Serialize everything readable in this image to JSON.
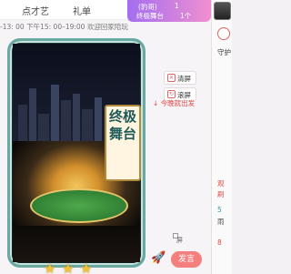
{
  "tabs": [
    {
      "label": "点才艺"
    },
    {
      "label": "礼单"
    }
  ],
  "banner": {
    "line1_a": "(豹哥)",
    "line1_b": "1",
    "line2_a": "终极舞台",
    "line2_b": "1个"
  },
  "notice": "-13: 00 下午15: 00–19:00 欢迎回家陪玩",
  "poster": {
    "title": "终极舞台"
  },
  "side_buttons": {
    "clear_label": "清屏",
    "scroll_label": "滚屏"
  },
  "red_message": "↓ 今晚就出发",
  "right_panel": {
    "item1": "观",
    "item2": "刷",
    "item3": "5",
    "item4": "8",
    "item5": "雨",
    "item6": "守护"
  },
  "input": {
    "screen_label": "屏",
    "send_label": "发言"
  },
  "stars_count": 3,
  "colors": {
    "accent": "#f57f7f",
    "banner_start": "#a36ef0",
    "banner_end": "#f08fd0"
  }
}
